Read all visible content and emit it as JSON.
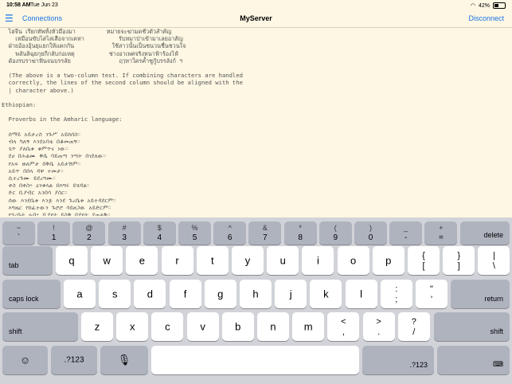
{
  "status_bar": {
    "time": "10:58 AM",
    "date": "Tue Jun 23",
    "battery": "42%",
    "battery_fraction": 0.42
  },
  "nav": {
    "left": "Connections",
    "title": "MyServer",
    "right": "Disconnect"
  },
  "terminal": {
    "lines": [
      "  ไฮจีน เรียกทัพทั้งหัวมืองมา         หมายจะฆ่ามดชั่วตัวสำคัญ",
      "    เหมือนขับไสไล่เสือจากเคหา          รับหมาป่าเข้ามาเลยอาสัญ",
      "  ฝ่ายอ้องอุ้นยุแยกให้แตกกัน           ใช้สาวนั้นเป็นชนวนชื่นชวนใจ",
      "    พลันลิฉุยกุยกีกลับก่อเหตุ          ช่างอาเพศจริงหนาฟ้าร้องไห้",
      "  ต้องรบราฆ่าฟันจนบรรลัย              ฤๅหาใครค้ำชูกู้บรรลังก์ ฯ",
      "",
      "  (The above is a two-column text. If combining characters are handled",
      "  correctly, the lines of the second column should be aligned with the",
      "  | character above.)",
      "",
      "Ethiopian:",
      "",
      "  Proverbs in the Amharic language:",
      "",
      "  ሰማይ አይታረስ ንጉሥ አይከሰስ።",
      "  ብላ ካለኝ እንደአባቴ በቆመጠኝ።",
      "  ጌጥ ያለቤቱ ቁምጥና ነው።",
      "  ደሀ በሕልሙ ቅቤ ባይጠጣ ንጣት በገደለው።",
      "  የአፍ ወለምታ በቅቤ አይታሽም።",
      "  አይጥ በበላ ዳዋ ተመታ።",
      "  ሲተረጉሙ ይደረግሙ።",
      "  ቀስ በቀስ፥ ዕንቁላል በእግሩ ይሄዳል።",
      "  ድር ቢያብር አንበሳ ያስር።",
      "  ሰው እንደቤቱ እንጅ እንደ ጉረቤቱ አይተዳደርም።",
      "  እግዜር የከፈተውን ጉሮሮ ሳይዘጋው አይድርም።",
      "  የጎረቤት ሌባ፥ ቢያዩት ይስቅ ባያዩት ያጠልቅ።",
      "  ሥራ ከመፍታት ልጄን ላፋታት።"
    ]
  },
  "keyboard": {
    "row1": [
      {
        "up": "~",
        "lo": "`"
      },
      {
        "up": "!",
        "lo": "1"
      },
      {
        "up": "@",
        "lo": "2"
      },
      {
        "up": "#",
        "lo": "3"
      },
      {
        "up": "$",
        "lo": "4"
      },
      {
        "up": "%",
        "lo": "5"
      },
      {
        "up": "^",
        "lo": "6"
      },
      {
        "up": "&",
        "lo": "7"
      },
      {
        "up": "*",
        "lo": "8"
      },
      {
        "up": "(",
        "lo": "9"
      },
      {
        "up": ")",
        "lo": "0"
      },
      {
        "up": "_",
        "lo": "-"
      },
      {
        "up": "+",
        "lo": "="
      }
    ],
    "delete": "delete",
    "tab": "tab",
    "row2": [
      "q",
      "w",
      "e",
      "r",
      "t",
      "y",
      "u",
      "i",
      "o",
      "p"
    ],
    "row2_sym": [
      {
        "up": "{",
        "lo": "["
      },
      {
        "up": "}",
        "lo": "]"
      },
      {
        "up": "|",
        "lo": "\\"
      }
    ],
    "caps": "caps lock",
    "row3": [
      "a",
      "s",
      "d",
      "f",
      "g",
      "h",
      "j",
      "k",
      "l"
    ],
    "row3_sym": [
      {
        "up": ":",
        "lo": ";"
      },
      {
        "up": "\"",
        "lo": "'"
      }
    ],
    "return": "return",
    "shift_left": "shift",
    "row4": [
      "z",
      "x",
      "c",
      "v",
      "b",
      "n",
      "m"
    ],
    "row4_sym": [
      {
        "up": "<",
        "lo": ","
      },
      {
        "up": ">",
        "lo": "."
      },
      {
        "up": "?",
        "lo": "/"
      }
    ],
    "shift_right": "shift",
    "emoji": "☺",
    "num_left": ".?123",
    "mic": "🎙",
    "num_right": ".?123",
    "hide": "⌨"
  }
}
